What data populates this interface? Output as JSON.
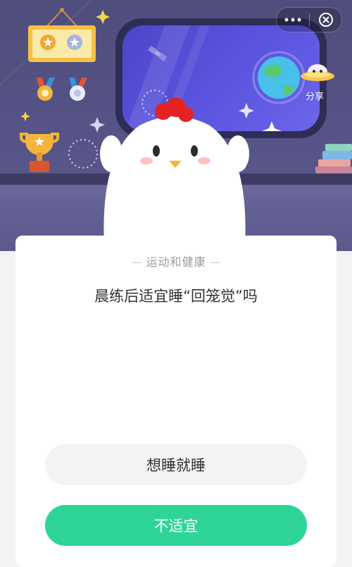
{
  "topbar": {
    "more_icon": "more-dots-icon",
    "close_icon": "close-circle-icon"
  },
  "scene": {
    "share_label": "分享"
  },
  "quiz": {
    "category": "运动和健康",
    "question": "晨练后适宜睡“回笼觉”吗",
    "options": [
      {
        "label": "想睡就睡"
      },
      {
        "label": "不适宜"
      }
    ]
  },
  "colors": {
    "accent_green": "#2fd596",
    "scene_purple": "#575588",
    "window_blue": "#5b55e0",
    "chicken_comb": "#e52222"
  }
}
